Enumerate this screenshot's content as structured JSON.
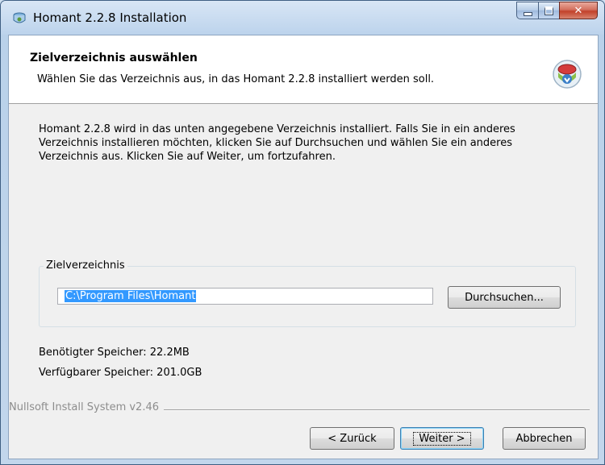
{
  "window": {
    "title": "Homant 2.2.8 Installation",
    "icon": "installer-icon"
  },
  "header": {
    "title": "Zielverzeichnis auswählen",
    "subtitle": "Wählen Sie das Verzeichnis aus, in das Homant 2.2.8 installiert werden soll.",
    "icon": "install-disc-icon"
  },
  "body": {
    "description": "Homant 2.2.8 wird in das unten angegebene Verzeichnis installiert. Falls Sie in ein anderes Verzeichnis installieren möchten, klicken Sie auf Durchsuchen und wählen Sie ein anderes Verzeichnis aus. Klicken Sie auf Weiter, um fortzufahren."
  },
  "destination": {
    "group_label": "Zielverzeichnis",
    "path_value": "C:\\Program Files\\Homant",
    "browse_label": "Durchsuchen..."
  },
  "space": {
    "required": "Benötigter Speicher: 22.2MB",
    "available": "Verfügbarer Speicher: 201.0GB"
  },
  "footer": {
    "branding": "Nullsoft Install System v2.46",
    "back_label": "< Zurück",
    "next_label": "Weiter >",
    "cancel_label": "Abbrechen"
  },
  "colors": {
    "selection": "#3399ff",
    "close_button": "#c2412a"
  }
}
